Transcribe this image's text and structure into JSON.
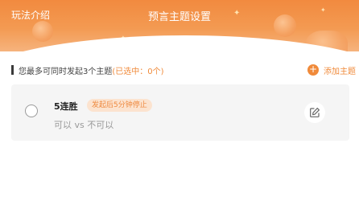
{
  "header": {
    "rules_link": "玩法介绍",
    "title": "预言主题设置"
  },
  "info": {
    "prefix": "您最多可同时发起3个主题",
    "selected": "(已选中：0个)"
  },
  "add_button": {
    "icon": "plus-icon",
    "label": "添加主题"
  },
  "topics": [
    {
      "name": "5连胜",
      "tag": "发起后5分钟停止",
      "options": "可以 vs 不可以",
      "edit_icon": "edit-icon"
    }
  ],
  "colors": {
    "brand_orange": "#f08a3a",
    "header_gradient_top": "#f28a3f",
    "tag_bg": "#fce3cf",
    "card_bg": "#f5f5f5"
  }
}
